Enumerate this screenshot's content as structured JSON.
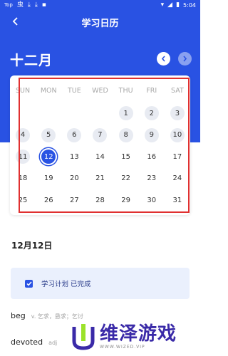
{
  "status_bar": {
    "carrier": "Top",
    "app_mark": "虫",
    "time": "5:04"
  },
  "header": {
    "title": "学习日历"
  },
  "calendar": {
    "month": "十二月",
    "weekdays": [
      "SUN",
      "MON",
      "TUE",
      "WED",
      "THU",
      "FRI",
      "SAT"
    ],
    "days": [
      "",
      "",
      "",
      "",
      "1",
      "2",
      "3",
      "4",
      "5",
      "6",
      "7",
      "8",
      "9",
      "10",
      "11",
      "12",
      "13",
      "14",
      "15",
      "16",
      "17",
      "18",
      "19",
      "20",
      "21",
      "22",
      "23",
      "24",
      "25",
      "26",
      "27",
      "28",
      "29",
      "30",
      "31"
    ],
    "past_days": [
      "1",
      "2",
      "3",
      "4",
      "5",
      "6",
      "7",
      "8",
      "9",
      "10",
      "11"
    ],
    "selected_day": "12"
  },
  "selected_date": "12月12日",
  "plan": {
    "status_text": "学习计划 已完成"
  },
  "words": [
    {
      "word": "beg",
      "definition": "v. 乞求，恳求；乞讨"
    },
    {
      "word": "devoted",
      "definition": "adj"
    }
  ],
  "watermark": {
    "main": "维泽游戏",
    "sub": "WWW.WIZED.VIP"
  },
  "colors": {
    "primary": "#2952e3",
    "highlight_border": "#e03030",
    "plan_bg": "#eaf0fd"
  }
}
